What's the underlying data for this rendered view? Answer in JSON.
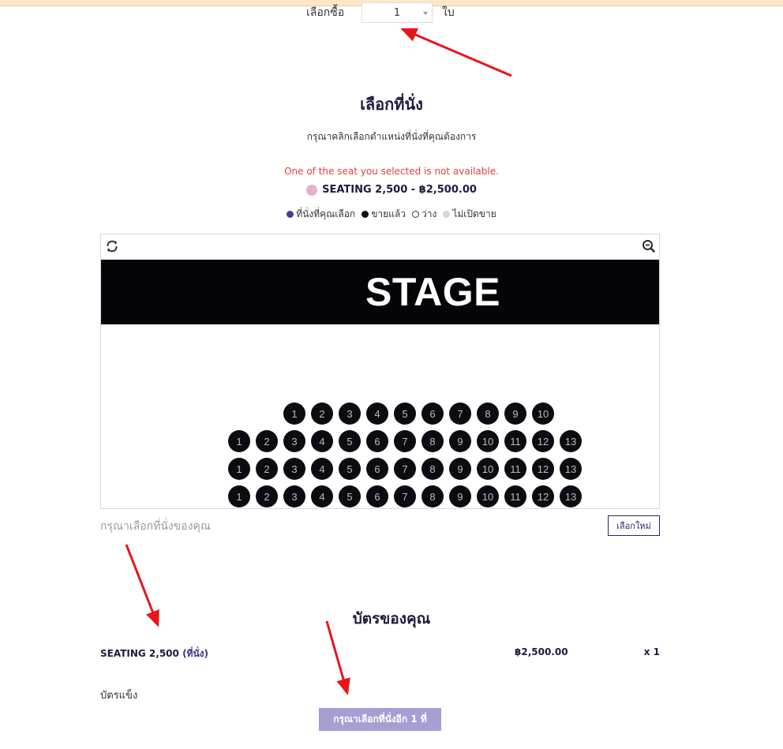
{
  "quantity": {
    "label": "เลือกซื้อ",
    "value": "1",
    "unit": "ใบ"
  },
  "seat_section": {
    "title": "เลือกที่นั่ง",
    "instruction": "กรุณาคลิกเลือกตำแหน่งที่นั่งที่คุณต้องการ",
    "error": "One of the seat you selected is not available.",
    "zone_label": "SEATING 2,500 - ฿2,500.00",
    "zone_color": "#e8aed0",
    "legend": [
      {
        "label": "ที่นั่งที่คุณเลือก",
        "color": "#4b3b9a"
      },
      {
        "label": "ขายแล้ว",
        "color": "#0b0b12"
      },
      {
        "label": "ว่าง",
        "color": "#ffffff"
      },
      {
        "label": "ไม่เปิดขาย",
        "color": "#d6d6d6"
      }
    ],
    "stage_label": "STAGE",
    "rows": [
      [
        "1",
        "2",
        "3",
        "4",
        "5",
        "6",
        "7",
        "8",
        "9",
        "10"
      ],
      [
        "1",
        "2",
        "3",
        "4",
        "5",
        "6",
        "7",
        "8",
        "9",
        "10",
        "11",
        "12",
        "13"
      ],
      [
        "1",
        "2",
        "3",
        "4",
        "5",
        "6",
        "7",
        "8",
        "9",
        "10",
        "11",
        "12",
        "13"
      ],
      [
        "1",
        "2",
        "3",
        "4",
        "5",
        "6",
        "7",
        "8",
        "9",
        "10",
        "11",
        "12",
        "13"
      ]
    ],
    "hint": "กรุณาเลือกที่นั่งของคุณ",
    "reset_label": "เลือกใหม่"
  },
  "tickets": {
    "title": "บัตรของคุณ",
    "name": "SEATING 2,500",
    "name_suffix": "(ที่นั่ง)",
    "price": "฿2,500.00",
    "qty": "x 1",
    "ticket_type": "บัตรแข็ง",
    "submit_label": "กรุณาเลือกที่นั่งอีก 1 ที่"
  },
  "colors": {
    "brand": "#2d2366",
    "sold_seat": "#0b0b12",
    "error": "#e0413a",
    "button_disabled": "#a79ed3",
    "annotation": "#e8141c"
  },
  "icons": {
    "refresh": "refresh-icon",
    "zoom_out": "zoom-out-icon"
  }
}
